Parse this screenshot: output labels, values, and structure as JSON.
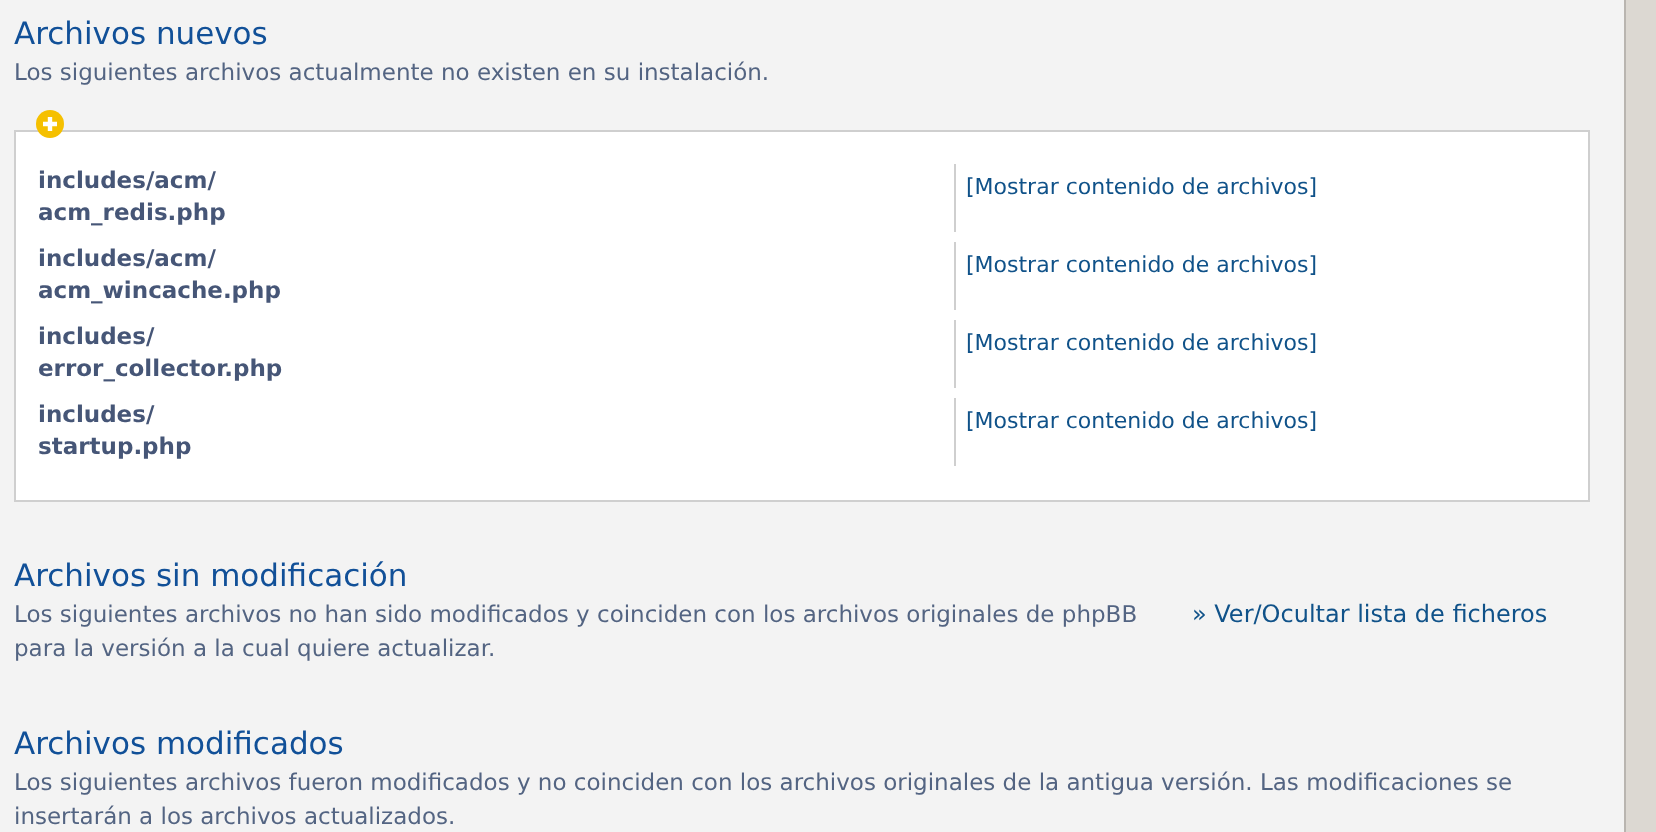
{
  "sections": [
    {
      "kind": "files",
      "title": "Archivos nuevos",
      "description": "Los siguientes archivos actualmente no existen en su instalación.",
      "files": [
        {
          "folder": "includes/acm/",
          "file": "acm_redis.php",
          "link": "[Mostrar contenido de archivos]"
        },
        {
          "folder": "includes/acm/",
          "file": "acm_wincache.php",
          "link": "[Mostrar contenido de archivos]"
        },
        {
          "folder": "includes/",
          "file": "error_collector.php",
          "link": "[Mostrar contenido de archivos]"
        },
        {
          "folder": "includes/",
          "file": "startup.php",
          "link": "[Mostrar contenido de archivos]"
        }
      ]
    },
    {
      "kind": "toggle",
      "title": "Archivos sin modificación",
      "description": "Los siguientes archivos no han sido modificados y coinciden con los archivos originales de phpBB para la versión a la cual quiere actualizar.",
      "link": "» Ver/Ocultar lista de ficheros"
    },
    {
      "kind": "plain",
      "title": "Archivos modificados",
      "description": "Los siguientes archivos fueron modificados y no coinciden con los archivos originales de la antigua versión. Las modificaciones se insertarán a los archivos actualizados."
    }
  ]
}
